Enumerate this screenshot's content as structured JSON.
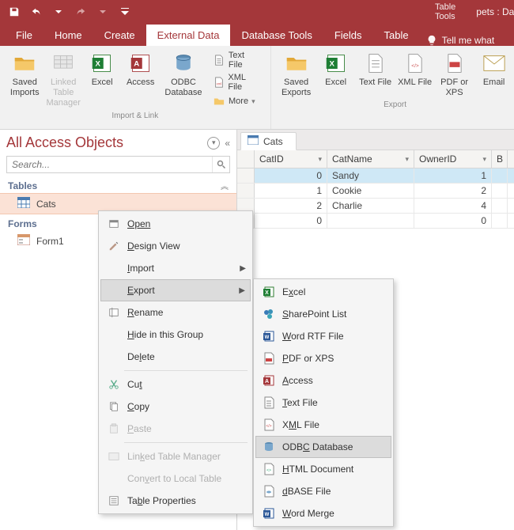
{
  "titlebar": {
    "table_tools": "Table Tools",
    "doc_title": "pets : Database-"
  },
  "tabs": {
    "file": "File",
    "home": "Home",
    "create": "Create",
    "external_data": "External Data",
    "database_tools": "Database Tools",
    "fields": "Fields",
    "table": "Table",
    "tell_me": "Tell me what"
  },
  "ribbon": {
    "import_link": {
      "saved_imports": "Saved Imports",
      "linked_table_manager": "Linked Table Manager",
      "excel": "Excel",
      "access": "Access",
      "odbc": "ODBC Database",
      "text_file": "Text File",
      "xml_file": "XML File",
      "more": "More",
      "group_label": "Import & Link"
    },
    "export": {
      "saved_exports": "Saved Exports",
      "excel": "Excel",
      "text_file": "Text File",
      "xml_file": "XML File",
      "pdf_xps": "PDF or XPS",
      "email": "Email",
      "group_label": "Export"
    }
  },
  "nav": {
    "title": "All Access Objects",
    "search_placeholder": "Search...",
    "groups": {
      "tables": "Tables",
      "forms": "Forms"
    },
    "items": {
      "cats": "Cats",
      "form1": "Form1"
    }
  },
  "datasheet": {
    "tab_name": "Cats",
    "columns": {
      "cat_id": "CatID",
      "cat_name": "CatName",
      "owner_id": "OwnerID",
      "b": "B"
    },
    "rows": [
      {
        "id": "0",
        "name": "Sandy",
        "owner": "1"
      },
      {
        "id": "1",
        "name": "Cookie",
        "owner": "2"
      },
      {
        "id": "2",
        "name": "Charlie",
        "owner": "4"
      },
      {
        "id": "0",
        "name": "",
        "owner": "0"
      }
    ]
  },
  "ctx1": {
    "open": "Open",
    "design_view": "Design View",
    "import": "Import",
    "export": "Export",
    "rename": "Rename",
    "hide": "Hide in this Group",
    "delete": "Delete",
    "cut": "Cut",
    "copy": "Copy",
    "paste": "Paste",
    "linked_tm": "Linked Table Manager",
    "convert_local": "Convert to Local Table",
    "table_props": "Table Properties"
  },
  "ctx2": {
    "excel": "Excel",
    "sharepoint": "SharePoint List",
    "word_rtf": "Word RTF File",
    "pdf_xps": "PDF or XPS",
    "access": "Access",
    "text_file": "Text File",
    "xml_file": "XML File",
    "odbc": "ODBC Database",
    "html": "HTML Document",
    "dbase": "dBASE File",
    "word_merge": "Word Merge"
  }
}
